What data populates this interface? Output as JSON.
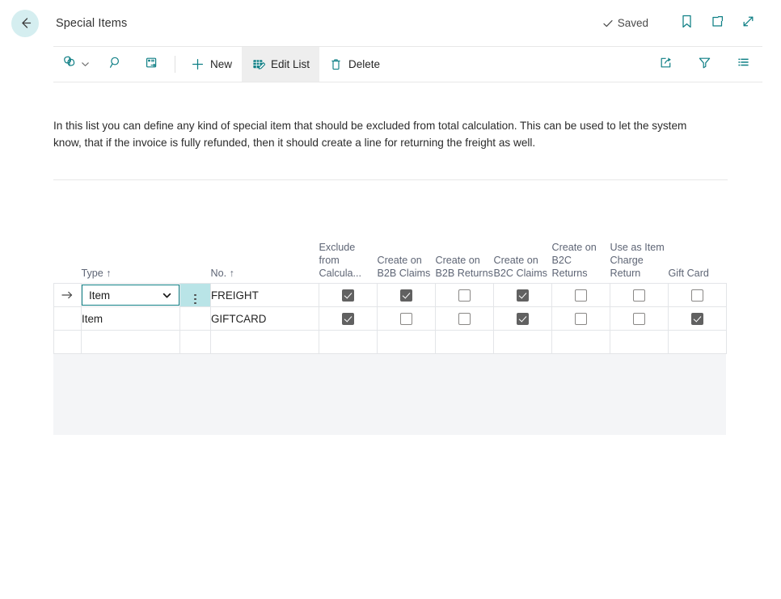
{
  "header": {
    "back_icon": "arrow-left-icon",
    "title": "Special Items",
    "saved_label": "Saved",
    "saved_icon": "check-icon",
    "icons": [
      {
        "name": "bookmark-icon"
      },
      {
        "name": "open-in-new-window-icon"
      },
      {
        "name": "expand-icon"
      }
    ]
  },
  "toolbar": {
    "left_icons": [
      {
        "name": "power-automate-icon",
        "has_chevron": true
      },
      {
        "name": "search-icon",
        "has_chevron": false
      },
      {
        "name": "open-in-excel-icon",
        "has_chevron": false
      }
    ],
    "buttons": [
      {
        "name": "new-button",
        "label": "New",
        "icon": "plus-icon",
        "active": false
      },
      {
        "name": "edit-list-button",
        "label": "Edit List",
        "icon": "edit-list-icon",
        "active": true
      },
      {
        "name": "delete-button",
        "label": "Delete",
        "icon": "trash-icon",
        "active": false
      }
    ],
    "right_icons": [
      {
        "name": "share-icon"
      },
      {
        "name": "filter-icon"
      },
      {
        "name": "list-options-icon"
      }
    ]
  },
  "description": "In this list you can define any kind of special item that should be excluded from total calculation. This can be used to let the system know, that if the invoice is fully refunded, then it should create a line for returning the freight as well.",
  "grid": {
    "columns": [
      {
        "key": "indicator",
        "label": ""
      },
      {
        "key": "type",
        "label": "Type ↑"
      },
      {
        "key": "menu",
        "label": ""
      },
      {
        "key": "no",
        "label": "No. ↑"
      },
      {
        "key": "exclude_from_calculation",
        "label": "Exclude from Calcula..."
      },
      {
        "key": "create_on_b2b_claims",
        "label": "Create on B2B Claims"
      },
      {
        "key": "create_on_b2b_returns",
        "label": "Create on B2B Returns"
      },
      {
        "key": "create_on_b2c_claims",
        "label": "Create on B2C Claims"
      },
      {
        "key": "create_on_b2c_returns",
        "label": "Create on B2C Returns"
      },
      {
        "key": "use_as_item_charge_return",
        "label": "Use as Item Charge Return"
      },
      {
        "key": "gift_card",
        "label": "Gift Card"
      }
    ],
    "rows": [
      {
        "selected": true,
        "indicator": "→",
        "type": "Item",
        "type_editing": true,
        "no": "FREIGHT",
        "exclude_from_calculation": true,
        "create_on_b2b_claims": true,
        "create_on_b2b_returns": false,
        "create_on_b2c_claims": true,
        "create_on_b2c_returns": false,
        "use_as_item_charge_return": false,
        "gift_card": false
      },
      {
        "selected": false,
        "indicator": "",
        "type": "Item",
        "type_editing": false,
        "no": "GIFTCARD",
        "exclude_from_calculation": true,
        "create_on_b2b_claims": false,
        "create_on_b2b_returns": false,
        "create_on_b2c_claims": true,
        "create_on_b2c_returns": false,
        "use_as_item_charge_return": false,
        "gift_card": true
      },
      {
        "selected": false,
        "indicator": "",
        "type": "",
        "type_editing": false,
        "no": "",
        "exclude_from_calculation": null,
        "create_on_b2b_claims": null,
        "create_on_b2b_returns": null,
        "create_on_b2c_claims": null,
        "create_on_b2c_returns": null,
        "use_as_item_charge_return": null,
        "gift_card": null
      }
    ]
  },
  "colors": {
    "accent": "#0f7f85",
    "selection": "#b9e4e7",
    "back_circle": "#d5eef0",
    "checkbox_on": "#616161",
    "header_text": "#5e6575",
    "filler": "#f4f5f7"
  }
}
